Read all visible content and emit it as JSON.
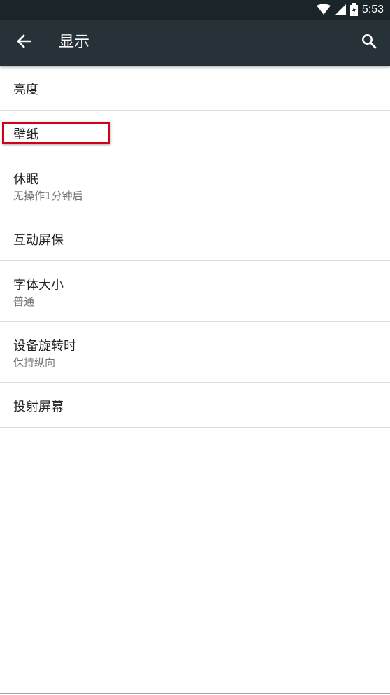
{
  "status_bar": {
    "time": "5:53",
    "icons": [
      "wifi-icon",
      "signal-icon",
      "battery-charging-icon"
    ]
  },
  "app_bar": {
    "back_icon": "arrow-left-icon",
    "title": "显示",
    "search_icon": "search-icon"
  },
  "settings": [
    {
      "title": "亮度",
      "summary": ""
    },
    {
      "title": "壁纸",
      "summary": ""
    },
    {
      "title": "休眠",
      "summary": "无操作1分钟后"
    },
    {
      "title": "互动屏保",
      "summary": ""
    },
    {
      "title": "字体大小",
      "summary": "普通"
    },
    {
      "title": "设备旋转时",
      "summary": "保持纵向"
    },
    {
      "title": "投射屏幕",
      "summary": ""
    }
  ],
  "colors": {
    "status_bar": "#1b2428",
    "app_bar": "#263238",
    "highlight": "#d0021b"
  }
}
